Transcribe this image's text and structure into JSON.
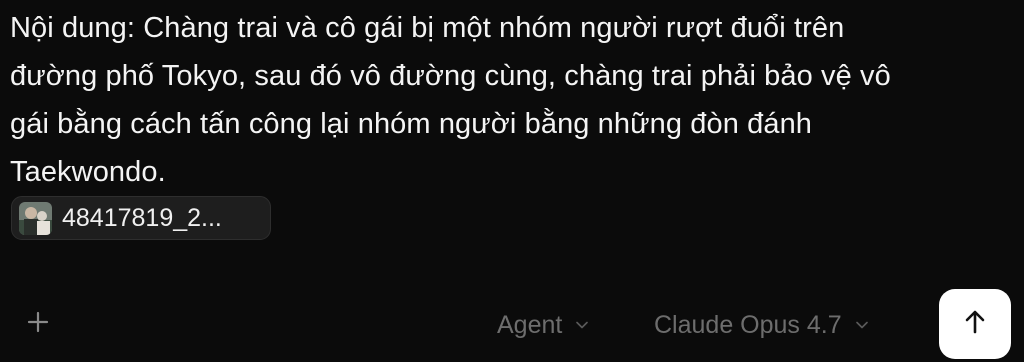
{
  "prompt": {
    "text": "Nội dung: Chàng trai và cô gái bị một nhóm người rượt đuổi trên\nđường phố Tokyo, sau đó vô đường cùng, chàng trai phải bảo vệ vô\ngái bằng cách tấn công lại nhóm người bằng những đòn đánh\nTaekwondo."
  },
  "attachment": {
    "filename": "48417819_2...",
    "thumbnail_icon": "image-thumbnail-icon"
  },
  "toolbar": {
    "add_icon": "plus-icon",
    "agent_label": "Agent",
    "model_label": "Claude Opus 4.7",
    "chevron_icon": "chevron-down-icon",
    "send_icon": "arrow-up-icon"
  },
  "colors": {
    "background": "#0b0b0b",
    "text": "#f4f4f4",
    "muted_text": "#6d6d6d",
    "chip_background": "#1e1e1e",
    "send_button": "#ffffff"
  }
}
